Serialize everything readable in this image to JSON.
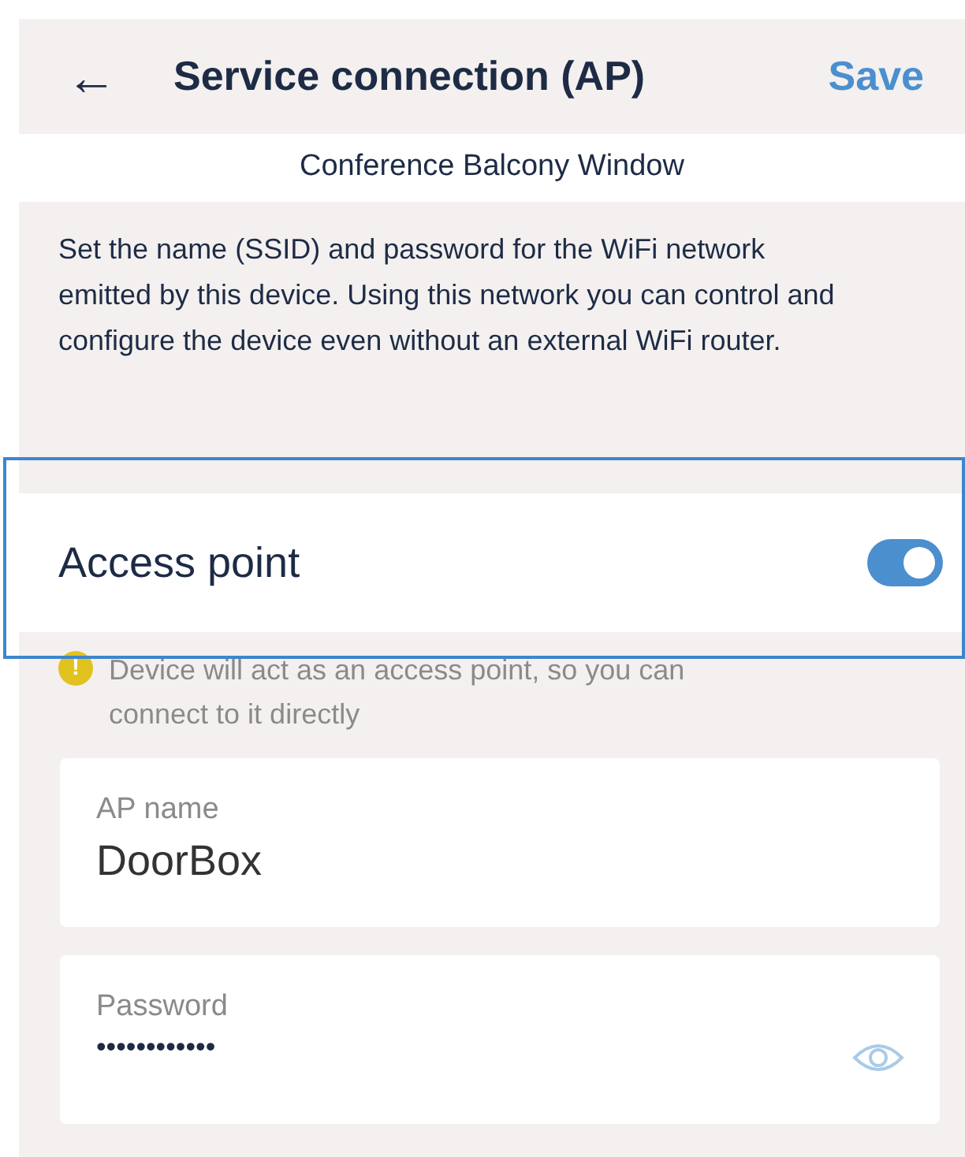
{
  "header": {
    "back": "←",
    "title": "Service connection (AP)",
    "action": "Save"
  },
  "subtitle": "Conference Balcony Window",
  "description": "Set the name (SSID) and password for the WiFi network emitted by this device. Using this network you can control and configure the device even without an external WiFi router.",
  "access_point": {
    "label": "Access point",
    "on": true,
    "highlighted": true
  },
  "notice": {
    "icon": "!",
    "text": "Device will act as an access point, so you can connect to it directly"
  },
  "fields": [
    {
      "kind": "text",
      "label": "AP name",
      "value": "DoorBox"
    },
    {
      "kind": "password",
      "label": "Password",
      "value": "••••••••••••"
    }
  ]
}
